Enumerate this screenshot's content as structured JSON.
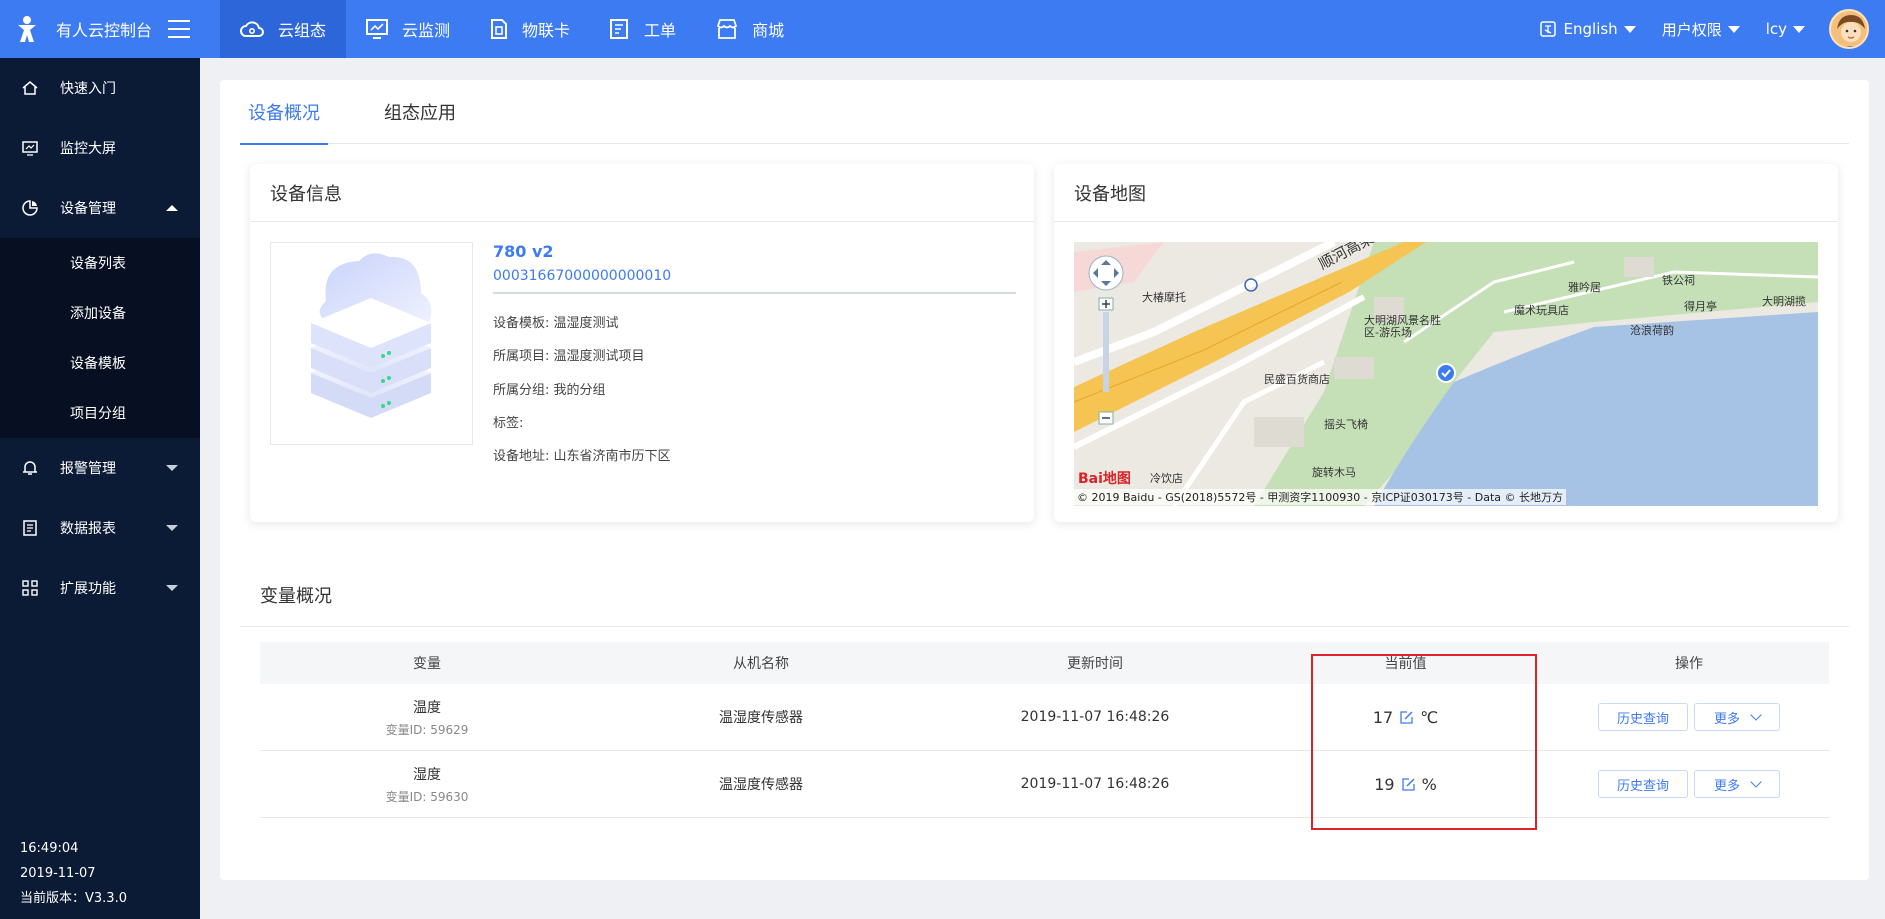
{
  "topbar": {
    "brand": "有人云控制台",
    "nav": [
      "云组态",
      "云监测",
      "物联卡",
      "工单",
      "商城"
    ],
    "language": "English",
    "permissions": "用户权限",
    "user": "lcy"
  },
  "sidebar": {
    "items": [
      "快速入门",
      "监控大屏",
      "设备管理",
      "报警管理",
      "数据报表",
      "扩展功能"
    ],
    "device_submenu": [
      "设备列表",
      "添加设备",
      "设备模板",
      "项目分组"
    ],
    "time": "16:49:04",
    "date": "2019-11-07",
    "version": "当前版本：V3.3.0"
  },
  "tabs": [
    "设备概况",
    "组态应用"
  ],
  "device_info": {
    "title": "设备信息",
    "name": "780 v2",
    "sn": "00031667000000000010",
    "template": "设备模板: 温湿度测试",
    "project": "所属项目: 温湿度测试项目",
    "group": "所属分组: 我的分组",
    "tags": "标签:",
    "address": "设备地址: 山东省济南市历下区"
  },
  "device_map": {
    "title": "设备地图",
    "labels": [
      "顺河高架",
      "大椿摩托",
      "民盛百货商店",
      "大明湖风景名胜区-游乐场",
      "雅吟居",
      "铁公祠",
      "魔术玩具店",
      "得月亭",
      "大明湖揽",
      "沧浪荷韵",
      "摇头飞椅",
      "旋转木马",
      "冷饮店"
    ],
    "copyright": "© 2019 Baidu - GS(2018)5572号 - 甲测资字1100930 - 京ICP证030173号 - Data © 长地万方",
    "logo": "Bai地图"
  },
  "variables": {
    "title": "变量概况",
    "columns": [
      "变量",
      "从机名称",
      "更新时间",
      "当前值",
      "操作"
    ],
    "rows": [
      {
        "name": "温度",
        "id": "变量ID: 59629",
        "slave": "温湿度传感器",
        "time": "2019-11-07 16:48:26",
        "value": "17",
        "unit": "℃",
        "history": "历史查询",
        "more": "更多"
      },
      {
        "name": "湿度",
        "id": "变量ID: 59630",
        "slave": "温湿度传感器",
        "time": "2019-11-07 16:48:26",
        "value": "19",
        "unit": "%",
        "history": "历史查询",
        "more": "更多"
      }
    ]
  },
  "colors": {
    "primary": "#3d7bf3",
    "sidebar": "#0b1a35",
    "highlight": "#e0232b"
  }
}
